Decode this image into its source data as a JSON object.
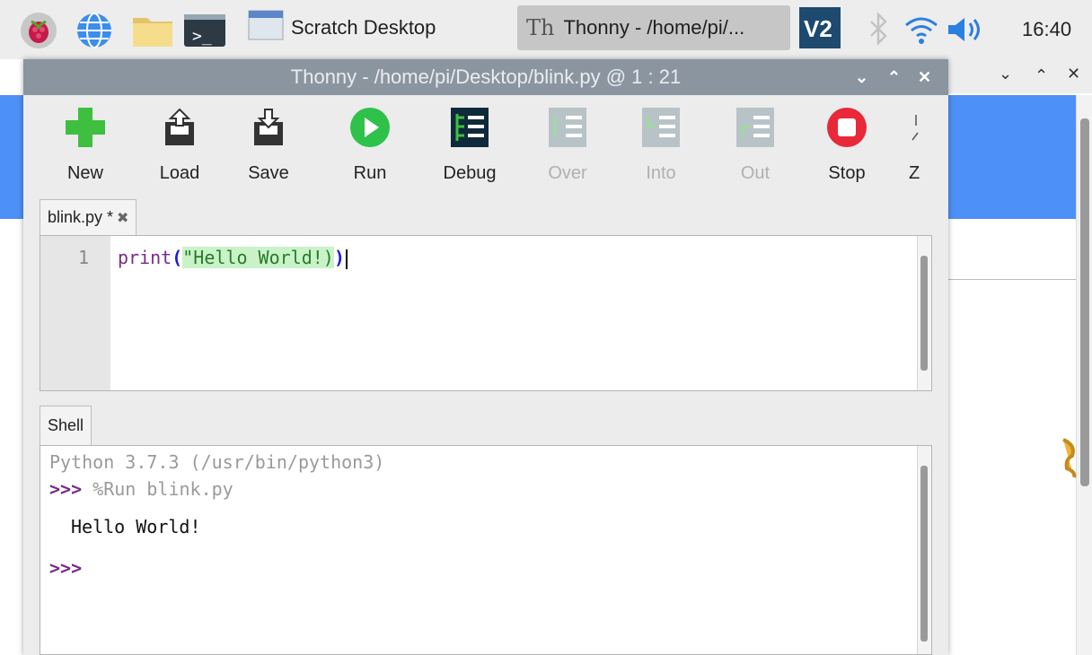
{
  "taskbar": {
    "icons": [
      "raspberry-menu-icon",
      "browser-globe-icon",
      "file-manager-folder-icon",
      "terminal-icon"
    ],
    "tasks": [
      {
        "label": "Scratch Desktop",
        "icon": "window-icon",
        "active": false
      },
      {
        "label": "Thonny  -  /home/pi/...",
        "icon": "thonny-icon",
        "active": true
      }
    ],
    "tray": {
      "vnc": "VNC",
      "clock": "16:40"
    }
  },
  "window": {
    "title": "Thonny  -  /home/pi/Desktop/blink.py  @  1 : 21",
    "controls": [
      "⌄",
      "⌃",
      "✕"
    ]
  },
  "toolbar": {
    "buttons": [
      {
        "label": "New",
        "icon": "new-plus-icon",
        "enabled": true
      },
      {
        "label": "Load",
        "icon": "load-icon",
        "enabled": true
      },
      {
        "label": "Save",
        "icon": "save-icon",
        "enabled": true
      },
      {
        "label": "Run",
        "icon": "run-play-icon",
        "enabled": true
      },
      {
        "label": "Debug",
        "icon": "debug-icon",
        "enabled": true
      },
      {
        "label": "Over",
        "icon": "step-over-icon",
        "enabled": false
      },
      {
        "label": "Into",
        "icon": "step-into-icon",
        "enabled": false
      },
      {
        "label": "Out",
        "icon": "step-out-icon",
        "enabled": false
      },
      {
        "label": "Stop",
        "icon": "stop-icon",
        "enabled": true
      },
      {
        "label": "Z",
        "icon": "zoom-icon",
        "enabled": true
      }
    ]
  },
  "editor": {
    "tab_label": "blink.py *",
    "line_number": "1",
    "code": {
      "func": "print",
      "open": "(",
      "string": "\"Hello World!)",
      "close": ")"
    }
  },
  "shell": {
    "tab_label": "Shell",
    "lines": {
      "banner": "Python 3.7.3 (/usr/bin/python3)",
      "prompt": ">>>",
      "command": " %Run blink.py",
      "output": "Hello World!",
      "prompt2": ">>>"
    }
  },
  "colors": {
    "titlebar": "#8b95a0",
    "accent_blue": "#4d90f7",
    "run_green": "#2ec24a",
    "stop_red": "#e8293a",
    "new_green": "#3fbf3f"
  }
}
